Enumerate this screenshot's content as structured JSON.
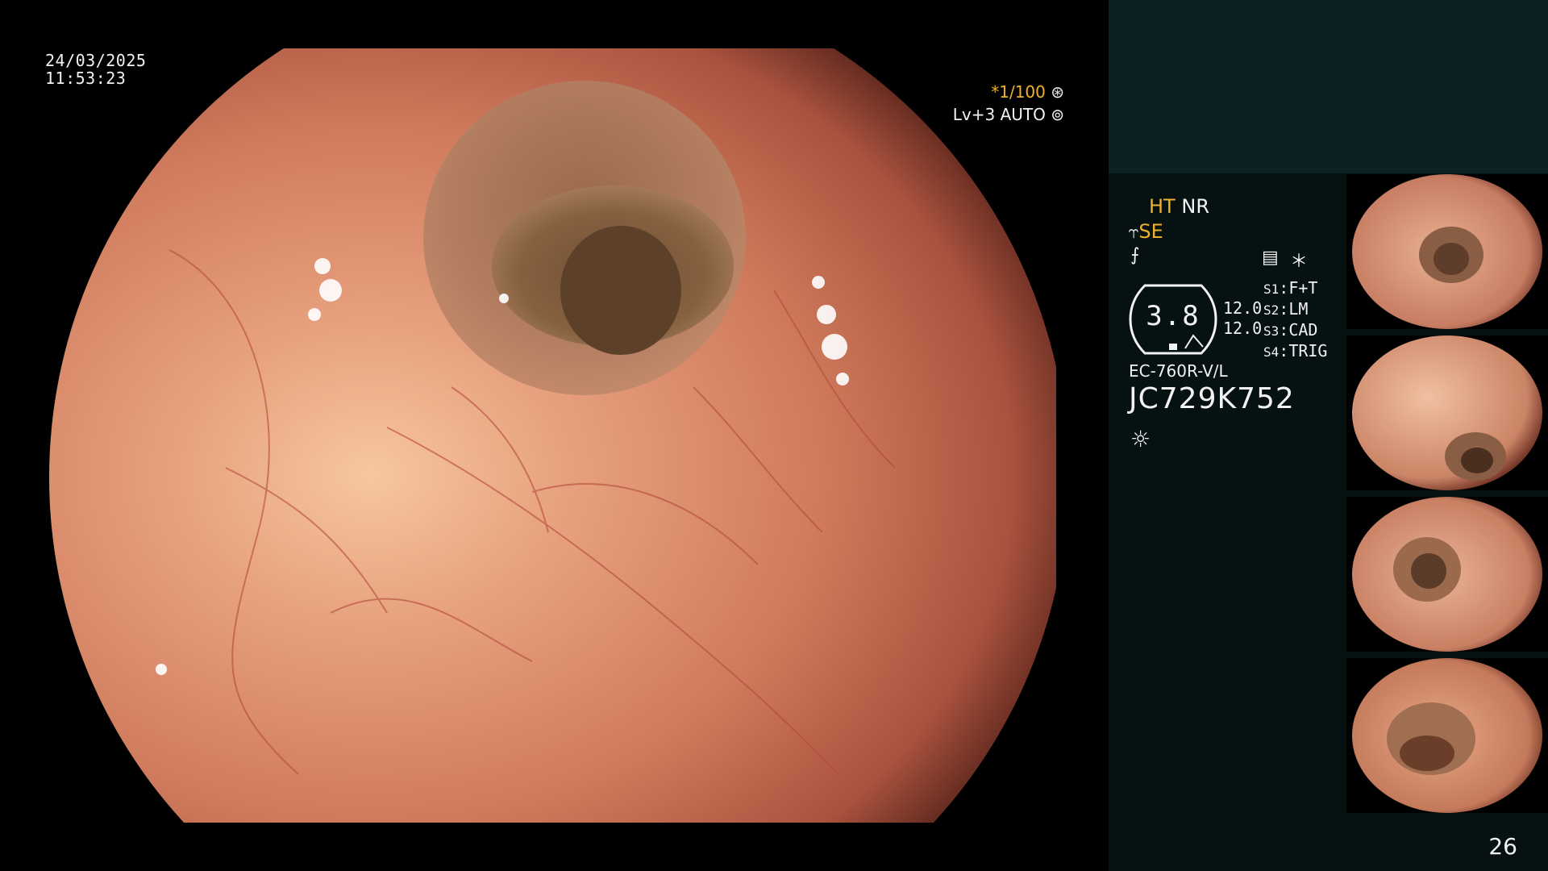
{
  "overlay": {
    "date": "24/03/2025",
    "time": "11:53:23",
    "shutter": "*1/100",
    "shutter_icon": "aperture-icon",
    "exposure": "Lv+3 AUTO",
    "exposure_icon": "exposure-icon"
  },
  "panel": {
    "mode_ht": "HT",
    "mode_nr": "NR",
    "mode_se": "SE",
    "gauge_value": "3.8",
    "gauge_sub1": "12.0",
    "gauge_sub2": "12.0",
    "settings": [
      {
        "key": "S1",
        "value": "F+T"
      },
      {
        "key": "S2",
        "value": "LM"
      },
      {
        "key": "S3",
        "value": "CAD"
      },
      {
        "key": "S4",
        "value": "TRIG"
      }
    ],
    "model": "EC-760R-V/L",
    "serial": "JC729K752",
    "page_number": "26",
    "colors": {
      "accent": "#f0b12a",
      "panel_bg": "#061111",
      "panel_top": "#0c2122",
      "text": "#f2f2f2"
    }
  },
  "thumbnails": [
    {
      "label": "thumbnail-1"
    },
    {
      "label": "thumbnail-2"
    },
    {
      "label": "thumbnail-3"
    },
    {
      "label": "thumbnail-4"
    }
  ]
}
